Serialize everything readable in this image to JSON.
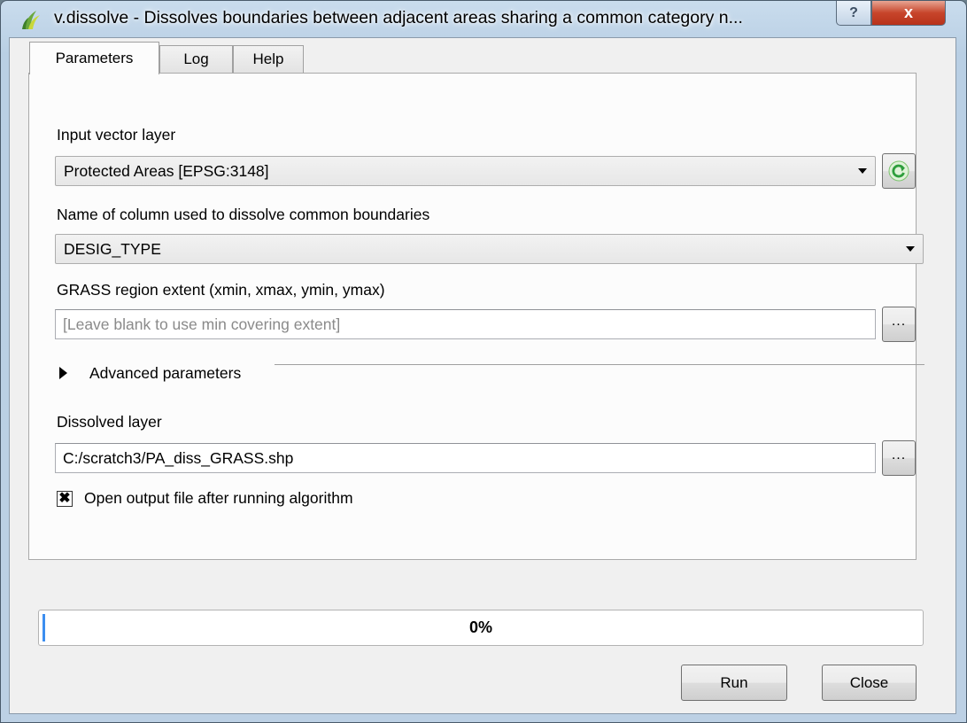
{
  "window": {
    "title": "v.dissolve - Dissolves boundaries between adjacent areas sharing a common category n...",
    "help_button": "?",
    "close_button": "x"
  },
  "tabs": [
    {
      "label": "Parameters",
      "active": true
    },
    {
      "label": "Log",
      "active": false
    },
    {
      "label": "Help",
      "active": false
    }
  ],
  "params": {
    "input_layer_label": "Input vector layer",
    "input_layer_value": "Protected Areas [EPSG:3148]",
    "column_label": "Name of column used to dissolve common boundaries",
    "column_value": "DESIG_TYPE",
    "extent_label": "GRASS region extent (xmin, xmax, ymin, ymax)",
    "extent_placeholder": "[Leave blank to use min covering extent]",
    "browse_label": "...",
    "advanced_label": "Advanced parameters",
    "output_label": "Dissolved layer",
    "output_value": "C:/scratch3/PA_diss_GRASS.shp",
    "open_output_label": "Open output file after running algorithm",
    "open_output_checked": true,
    "checkbox_mark": "✖"
  },
  "progress": {
    "text": "0%",
    "value": 0
  },
  "buttons": {
    "run": "Run",
    "close": "Close"
  },
  "colors": {
    "accent": "#3c8ef0",
    "refresh_icon": "#3aa84a"
  },
  "icons": {
    "app": "grass-icon",
    "refresh": "refresh-icon",
    "dropdown": "chevron-down-icon"
  }
}
